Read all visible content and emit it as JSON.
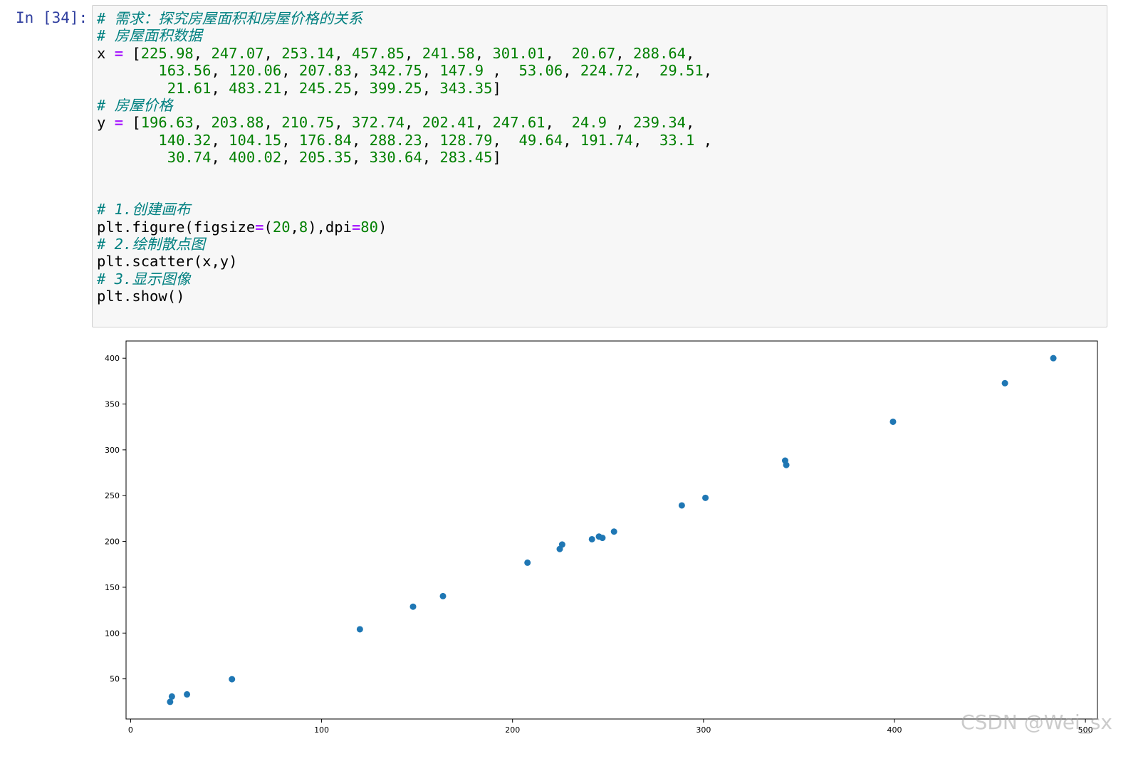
{
  "prompt": "In [34]:",
  "code_lines": [
    [
      {
        "t": "# 需求：探究房屋面积和房屋价格的关系",
        "c": "cm"
      }
    ],
    [
      {
        "t": "# 房屋面积数据",
        "c": "cm"
      }
    ],
    [
      {
        "t": "x "
      },
      {
        "t": "=",
        "c": "kw"
      },
      {
        "t": " ["
      },
      {
        "t": "225.98",
        "c": "nm"
      },
      {
        "t": ", "
      },
      {
        "t": "247.07",
        "c": "nm"
      },
      {
        "t": ", "
      },
      {
        "t": "253.14",
        "c": "nm"
      },
      {
        "t": ", "
      },
      {
        "t": "457.85",
        "c": "nm"
      },
      {
        "t": ", "
      },
      {
        "t": "241.58",
        "c": "nm"
      },
      {
        "t": ", "
      },
      {
        "t": "301.01",
        "c": "nm"
      },
      {
        "t": ",  "
      },
      {
        "t": "20.67",
        "c": "nm"
      },
      {
        "t": ", "
      },
      {
        "t": "288.64",
        "c": "nm"
      },
      {
        "t": ","
      }
    ],
    [
      {
        "t": "       "
      },
      {
        "t": "163.56",
        "c": "nm"
      },
      {
        "t": ", "
      },
      {
        "t": "120.06",
        "c": "nm"
      },
      {
        "t": ", "
      },
      {
        "t": "207.83",
        "c": "nm"
      },
      {
        "t": ", "
      },
      {
        "t": "342.75",
        "c": "nm"
      },
      {
        "t": ", "
      },
      {
        "t": "147.9",
        "c": "nm"
      },
      {
        "t": " ,  "
      },
      {
        "t": "53.06",
        "c": "nm"
      },
      {
        "t": ", "
      },
      {
        "t": "224.72",
        "c": "nm"
      },
      {
        "t": ",  "
      },
      {
        "t": "29.51",
        "c": "nm"
      },
      {
        "t": ","
      }
    ],
    [
      {
        "t": "        "
      },
      {
        "t": "21.61",
        "c": "nm"
      },
      {
        "t": ", "
      },
      {
        "t": "483.21",
        "c": "nm"
      },
      {
        "t": ", "
      },
      {
        "t": "245.25",
        "c": "nm"
      },
      {
        "t": ", "
      },
      {
        "t": "399.25",
        "c": "nm"
      },
      {
        "t": ", "
      },
      {
        "t": "343.35",
        "c": "nm"
      },
      {
        "t": "]"
      }
    ],
    [
      {
        "t": "# 房屋价格",
        "c": "cm"
      }
    ],
    [
      {
        "t": "y "
      },
      {
        "t": "=",
        "c": "kw"
      },
      {
        "t": " ["
      },
      {
        "t": "196.63",
        "c": "nm"
      },
      {
        "t": ", "
      },
      {
        "t": "203.88",
        "c": "nm"
      },
      {
        "t": ", "
      },
      {
        "t": "210.75",
        "c": "nm"
      },
      {
        "t": ", "
      },
      {
        "t": "372.74",
        "c": "nm"
      },
      {
        "t": ", "
      },
      {
        "t": "202.41",
        "c": "nm"
      },
      {
        "t": ", "
      },
      {
        "t": "247.61",
        "c": "nm"
      },
      {
        "t": ",  "
      },
      {
        "t": "24.9",
        "c": "nm"
      },
      {
        "t": " , "
      },
      {
        "t": "239.34",
        "c": "nm"
      },
      {
        "t": ","
      }
    ],
    [
      {
        "t": "       "
      },
      {
        "t": "140.32",
        "c": "nm"
      },
      {
        "t": ", "
      },
      {
        "t": "104.15",
        "c": "nm"
      },
      {
        "t": ", "
      },
      {
        "t": "176.84",
        "c": "nm"
      },
      {
        "t": ", "
      },
      {
        "t": "288.23",
        "c": "nm"
      },
      {
        "t": ", "
      },
      {
        "t": "128.79",
        "c": "nm"
      },
      {
        "t": ",  "
      },
      {
        "t": "49.64",
        "c": "nm"
      },
      {
        "t": ", "
      },
      {
        "t": "191.74",
        "c": "nm"
      },
      {
        "t": ",  "
      },
      {
        "t": "33.1",
        "c": "nm"
      },
      {
        "t": " ,"
      }
    ],
    [
      {
        "t": "        "
      },
      {
        "t": "30.74",
        "c": "nm"
      },
      {
        "t": ", "
      },
      {
        "t": "400.02",
        "c": "nm"
      },
      {
        "t": ", "
      },
      {
        "t": "205.35",
        "c": "nm"
      },
      {
        "t": ", "
      },
      {
        "t": "330.64",
        "c": "nm"
      },
      {
        "t": ", "
      },
      {
        "t": "283.45",
        "c": "nm"
      },
      {
        "t": "]"
      }
    ],
    [],
    [],
    [
      {
        "t": "# 1.创建画布",
        "c": "cm"
      }
    ],
    [
      {
        "t": "plt.figure(figsize"
      },
      {
        "t": "=",
        "c": "kw"
      },
      {
        "t": "("
      },
      {
        "t": "20",
        "c": "nm"
      },
      {
        "t": ","
      },
      {
        "t": "8",
        "c": "nm"
      },
      {
        "t": "),dpi"
      },
      {
        "t": "=",
        "c": "kw"
      },
      {
        "t": "80",
        "c": "nm"
      },
      {
        "t": ")"
      }
    ],
    [
      {
        "t": "# 2.绘制散点图",
        "c": "cm"
      }
    ],
    [
      {
        "t": "plt.scatter(x,y)"
      }
    ],
    [
      {
        "t": "# 3.显示图像",
        "c": "cm"
      }
    ],
    [
      {
        "t": "plt.show()"
      }
    ]
  ],
  "chart_data": {
    "type": "scatter",
    "title": "",
    "xlabel": "",
    "ylabel": "",
    "x": [
      225.98,
      247.07,
      253.14,
      457.85,
      241.58,
      301.01,
      20.67,
      288.64,
      163.56,
      120.06,
      207.83,
      342.75,
      147.9,
      53.06,
      224.72,
      29.51,
      21.61,
      483.21,
      245.25,
      399.25,
      343.35
    ],
    "y": [
      196.63,
      203.88,
      210.75,
      372.74,
      202.41,
      247.61,
      24.9,
      239.34,
      140.32,
      104.15,
      176.84,
      288.23,
      128.79,
      49.64,
      191.74,
      33.1,
      30.74,
      400.02,
      205.35,
      330.64,
      283.45
    ],
    "xlim": [
      -2.4,
      506.3
    ],
    "ylim": [
      6.2,
      418.8
    ],
    "xticks": [
      "0",
      "100",
      "200",
      "300",
      "400",
      "500"
    ],
    "yticks": [
      "50",
      "100",
      "150",
      "200",
      "250",
      "300",
      "350",
      "400"
    ],
    "marker_color": "#1f77b4",
    "grid": false
  },
  "watermark": "CSDN @Wei_sx"
}
